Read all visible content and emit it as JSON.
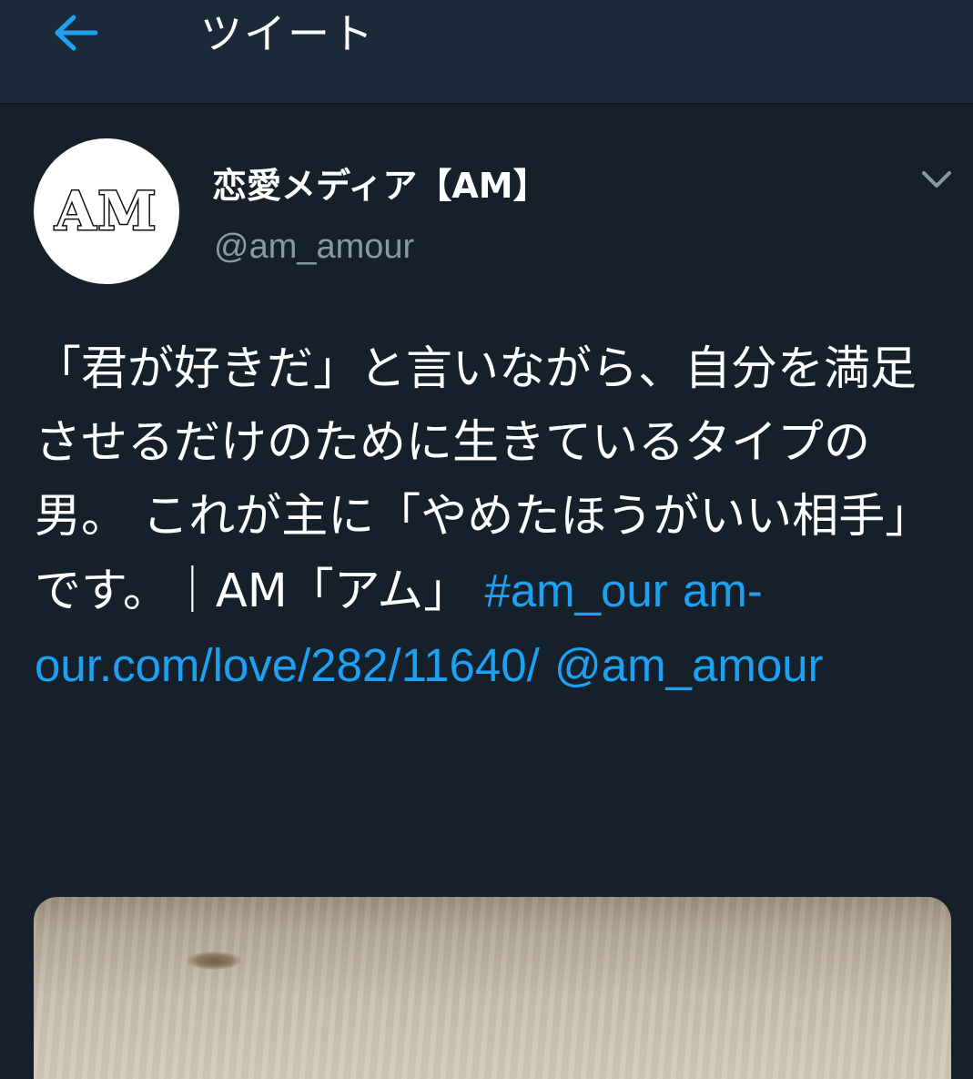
{
  "header": {
    "back_icon": "arrow-left-icon",
    "title": "ツイート"
  },
  "tweet": {
    "author": {
      "display_name": "恋愛メディア【AM】",
      "handle": "@am_amour",
      "avatar_text": "AM"
    },
    "menu_icon": "chevron-down-icon",
    "text": {
      "body": "「君が好きだ」と言いながら、自分を満足させるだけのために生きているタイプの男。 これが主に「やめたほうがいい相手」です。｜AM「アム」",
      "hashtag": "#am_our",
      "url": "am-our.com/love/282/11640/",
      "mention": "@am_amour"
    }
  },
  "colors": {
    "background": "#15202b",
    "header_background": "#1c2938",
    "accent": "#1da1f2",
    "secondary_text": "#8899a6"
  }
}
